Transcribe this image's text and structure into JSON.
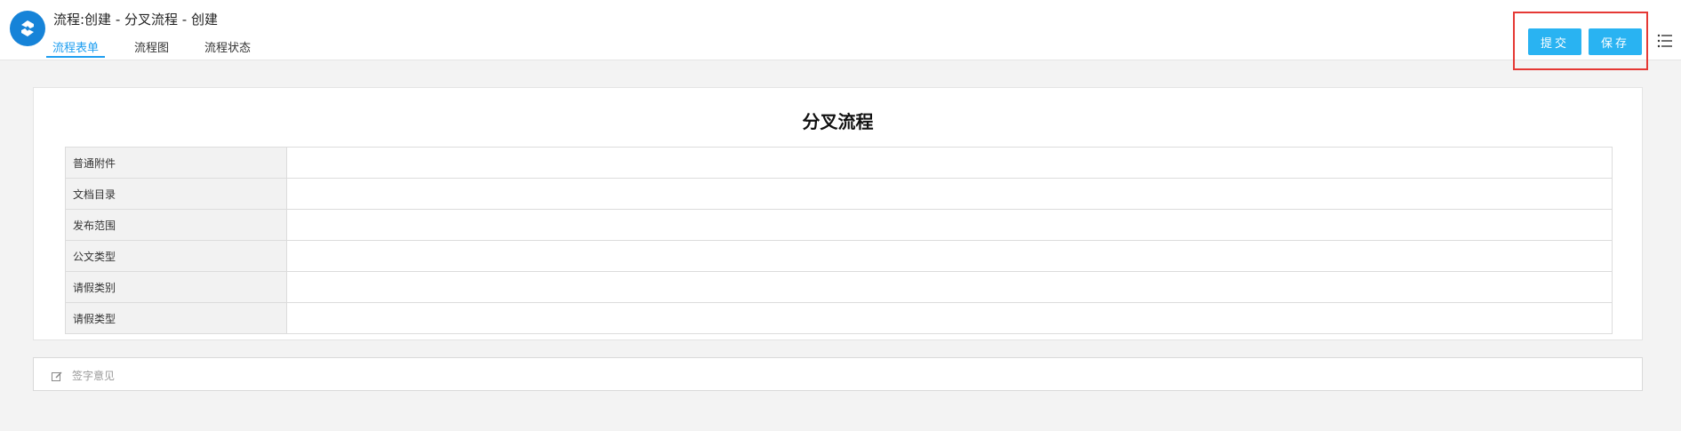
{
  "header": {
    "title": "流程:创建 - 分叉流程 - 创建",
    "logo_icon": "flow-logo-icon",
    "tabs": [
      {
        "label": "流程表单",
        "active": true
      },
      {
        "label": "流程图",
        "active": false
      },
      {
        "label": "流程状态",
        "active": false
      }
    ],
    "actions": {
      "submit_label": "提交",
      "save_label": "保存"
    },
    "menu_icon": "list-menu-icon"
  },
  "form": {
    "title": "分叉流程",
    "rows": [
      {
        "label": "普通附件",
        "value": ""
      },
      {
        "label": "文档目录",
        "value": ""
      },
      {
        "label": "发布范围",
        "value": ""
      },
      {
        "label": "公文类型",
        "value": ""
      },
      {
        "label": "请假类别",
        "value": ""
      },
      {
        "label": "请假类型",
        "value": ""
      }
    ]
  },
  "opinion": {
    "icon": "edit-icon",
    "placeholder": "签字意见"
  },
  "colors": {
    "accent": "#1e9ef0",
    "button": "#29b3f2",
    "highlight_border": "#e53935",
    "logo": "#1683d8"
  }
}
